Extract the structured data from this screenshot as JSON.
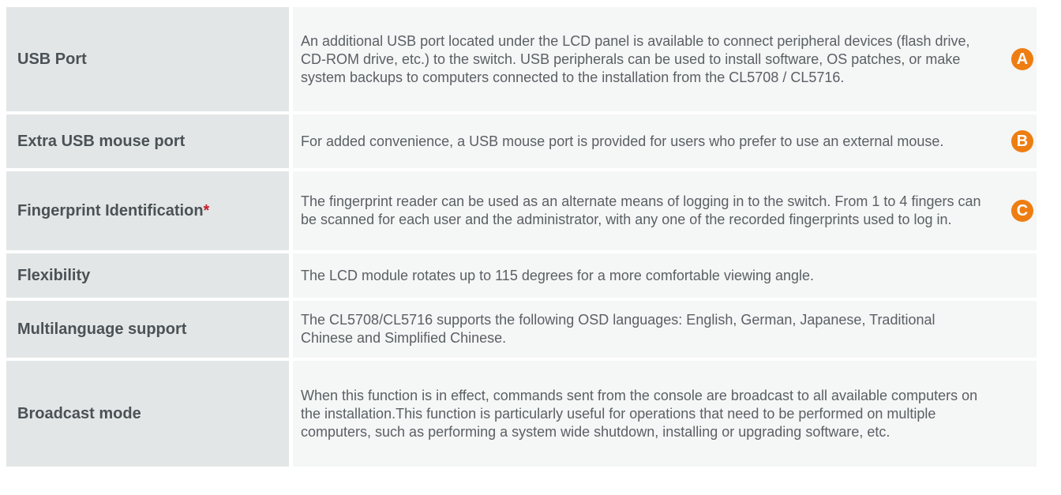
{
  "rows": [
    {
      "label": "USB Port",
      "asterisk": "",
      "description": "An additional USB port located under the LCD panel is available to connect peripheral devices (flash drive, CD-ROM drive, etc.) to the switch. USB peripherals can be used to install software, OS patches, or make system backups to computers connected to the installation from the CL5708 / CL5716.",
      "badge": "A"
    },
    {
      "label": "Extra USB mouse port",
      "asterisk": "",
      "description": "For added convenience, a USB mouse port is provided for users who prefer to use an external mouse.",
      "badge": "B"
    },
    {
      "label": "Fingerprint Identification",
      "asterisk": "*",
      "description": "The fingerprint reader can be used as an alternate means of logging in to the switch. From 1 to 4 fingers can be scanned for each user and the administrator, with any one of the recorded fingerprints used to log in.",
      "badge": "C"
    },
    {
      "label": "Flexibility",
      "asterisk": "",
      "description": "The LCD module rotates up to 115 degrees for a more comfortable viewing angle.",
      "badge": ""
    },
    {
      "label": "Multilanguage support",
      "asterisk": "",
      "description": "The CL5708/CL5716 supports the following OSD languages: English, German, Japanese, Traditional Chinese and Simplified Chinese.",
      "badge": ""
    },
    {
      "label": "Broadcast mode",
      "asterisk": "",
      "description": "When this function is in effect, commands sent from the console are broadcast to all available computers on the installation.This function is particularly useful for operations that need to be performed on multiple computers, such as performing a system wide shutdown, installing or upgrading software, etc.",
      "badge": ""
    }
  ],
  "colors": {
    "label_bg": "#e3e6e6",
    "desc_bg": "#f5f6f6",
    "badge": "#ee7d12",
    "asterisk": "#c41c2f"
  }
}
